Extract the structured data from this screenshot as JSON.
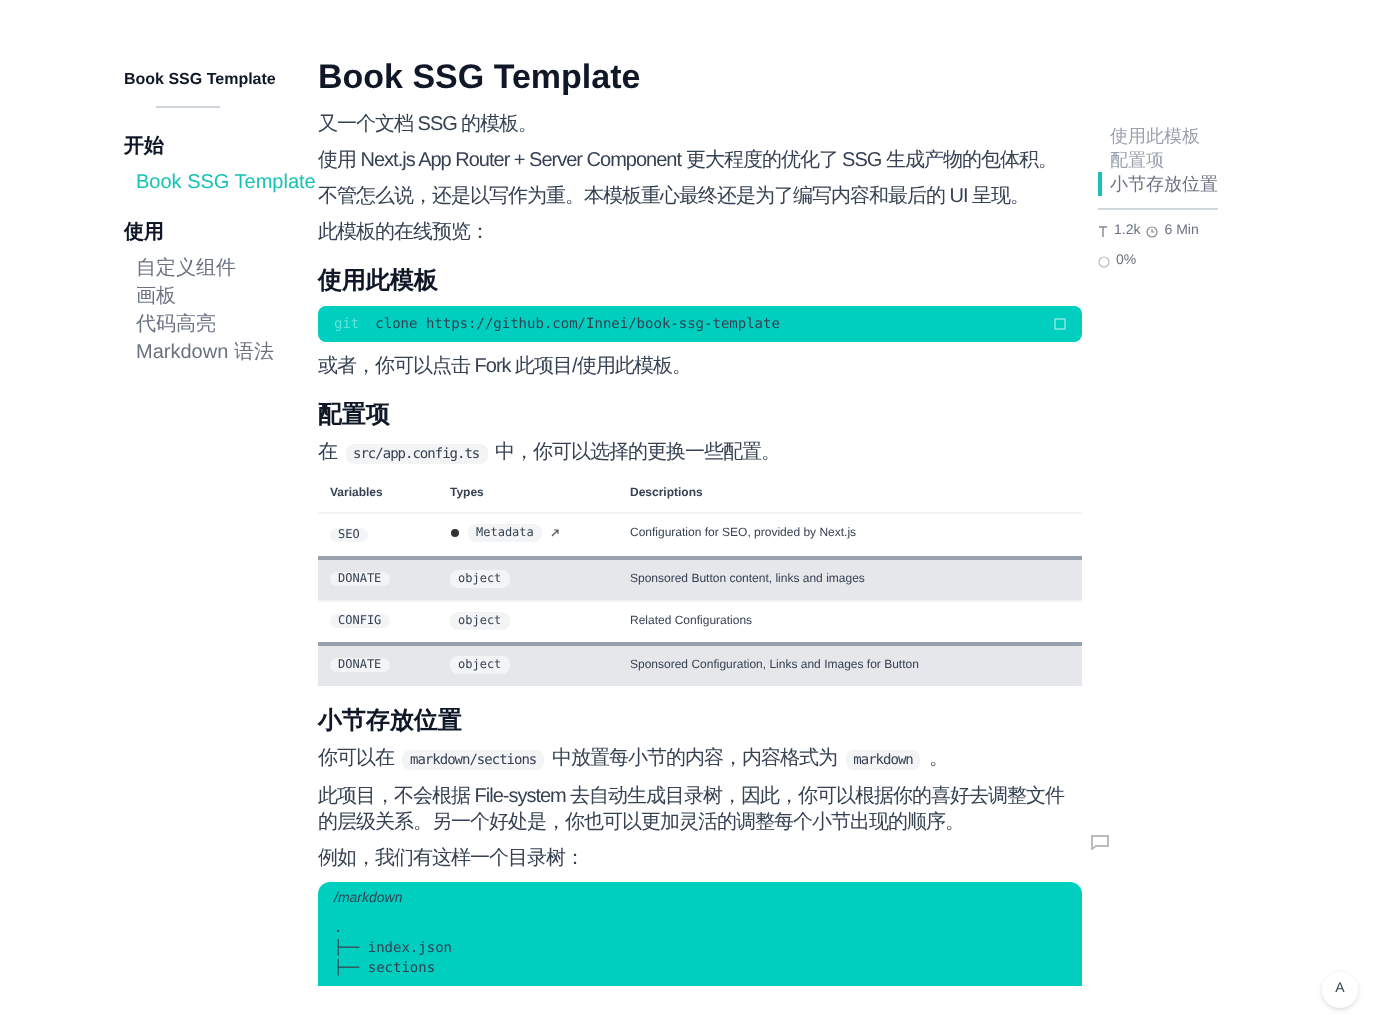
{
  "sidebar": {
    "title": "Book SSG Template",
    "groups": [
      {
        "heading": "开始",
        "items": [
          {
            "label": "Book SSG Template",
            "selected": true
          }
        ]
      },
      {
        "heading": "使用",
        "items": [
          {
            "label": "自定义组件",
            "selected": false
          },
          {
            "label": "画板",
            "selected": false
          },
          {
            "label": "代码高亮",
            "selected": false
          },
          {
            "label": "Markdown 语法",
            "selected": false
          }
        ]
      }
    ]
  },
  "article": {
    "title": "Book SSG Template",
    "blocks": [
      {
        "kind": "p",
        "segments": [
          {
            "kind": "text",
            "text": "又一个文档 SSG 的模板。"
          }
        ]
      },
      {
        "kind": "p",
        "segments": [
          {
            "kind": "text",
            "text": "使用 Next.js App Router + Server Component 更大程度的优化了 SSG 生成产物的包体积。"
          }
        ]
      },
      {
        "kind": "p",
        "segments": [
          {
            "kind": "text",
            "text": "不管怎么说，还是以写作为重。本模板重心最终还是为了编写内容和最后的 UI 呈现。"
          }
        ]
      },
      {
        "kind": "p",
        "segments": [
          {
            "kind": "text",
            "text": "此模板的在线预览："
          }
        ]
      },
      {
        "kind": "h2",
        "text": "使用此模板"
      },
      {
        "kind": "code",
        "prompt": "git",
        "code": "clone https://github.com/Innei/book-ssg-template"
      },
      {
        "kind": "p",
        "segments": [
          {
            "kind": "text",
            "text": "或者，你可以点击 Fork 此项目/使用此模板。"
          }
        ]
      },
      {
        "kind": "h2",
        "text": "配置项"
      },
      {
        "kind": "p",
        "segments": [
          {
            "kind": "text",
            "text": "在"
          },
          {
            "kind": "code",
            "text": "src/app.config.ts"
          },
          {
            "kind": "text",
            "text": "中，你可以选择的更换一些配置。"
          }
        ]
      },
      {
        "kind": "table",
        "columns": [
          "Variables",
          "Types",
          "Descriptions"
        ],
        "rows": [
          {
            "variable": "SEO",
            "type": "Metadata",
            "link": true,
            "description": "Configuration for SEO, provided by Next.js",
            "shaded": false
          },
          {
            "variable": "DONATE",
            "type": "object",
            "link": false,
            "description": "Sponsored Button content, links and images",
            "shaded": true
          },
          {
            "variable": "CONFIG",
            "type": "object",
            "link": false,
            "description": "Related Configurations",
            "shaded": false
          },
          {
            "variable": "DONATE",
            "type": "object",
            "link": false,
            "description": "Sponsored Configuration, Links and Images for Button",
            "shaded": true
          }
        ]
      },
      {
        "kind": "h2",
        "text": "小节存放位置"
      },
      {
        "kind": "p",
        "segments": [
          {
            "kind": "text",
            "text": "你可以在"
          },
          {
            "kind": "code",
            "text": "markdown/sections"
          },
          {
            "kind": "text",
            "text": "中放置每小节的内容，内容格式为"
          },
          {
            "kind": "code",
            "text": "markdown"
          },
          {
            "kind": "text",
            "text": "。"
          }
        ]
      },
      {
        "kind": "p",
        "segments": [
          {
            "kind": "text",
            "text": "此项目，不会根据 File-system 去自动生成目录树，因此，你可以根据你的喜好去调整文件的层级关系。另一个好处是，你也可以更加灵活的调整每个小节出现的顺序。"
          }
        ]
      },
      {
        "kind": "p",
        "segments": [
          {
            "kind": "text",
            "text": "例如，我们有这样一个目录树："
          }
        ]
      },
      {
        "kind": "tree",
        "title": "/markdown",
        "lines": [
          ".",
          "├── index.json",
          "├── sections"
        ]
      }
    ]
  },
  "toc": {
    "items": [
      {
        "label": "使用此模板",
        "selected": false
      },
      {
        "label": "配置项",
        "selected": false
      },
      {
        "label": "小节存放位置",
        "selected": true
      }
    ],
    "words": "1.2k",
    "time": "6 Min",
    "progress": {
      "text": "0%",
      "level": 0
    }
  },
  "font_button": "A"
}
